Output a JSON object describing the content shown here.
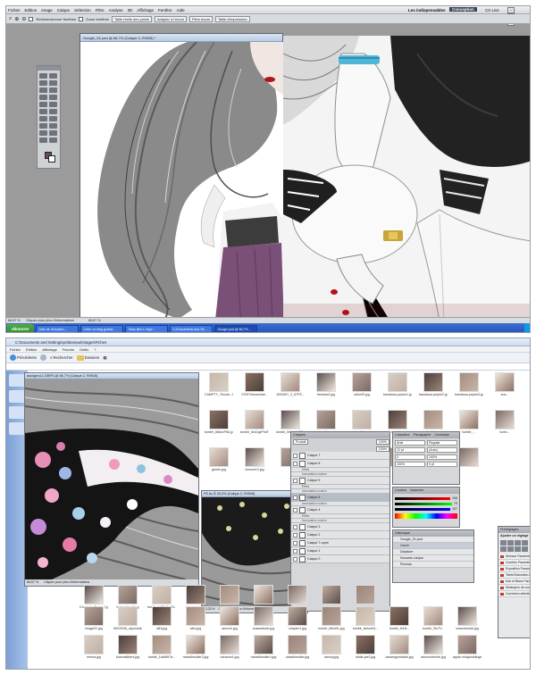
{
  "photoshop": {
    "menu": [
      "Fichier",
      "Edition",
      "Image",
      "Calque",
      "Sélection",
      "Filtre",
      "Analyse",
      "3D",
      "Affichage",
      "Fenêtre",
      "Aide"
    ],
    "workspace": [
      "Les indispensables",
      "Conception"
    ],
    "cs_live": "CS Live",
    "options": {
      "antialias_label": "Redimensionner fenêtres",
      "zoom_all_label": "Zoom fenêtres",
      "btn_actual_pixels": "Taille réelle des pixels",
      "btn_fit_screen": "Adapter à l'écran",
      "btn_fill_screen": "Plein écran",
      "btn_print_size": "Taille d'impression"
    },
    "document": {
      "title": "Google_S1.psd @ 66,7% (Calque 3, RVB/8) *"
    },
    "status": {
      "zoom": "66,67 %",
      "hint": "Cliquez pour plus d'informations",
      "zoom2": "66,67 %"
    },
    "taskbar": {
      "start": "démarrer",
      "tasks": [
        "Aide de réception...",
        "Créer un blog gratuit...",
        "Sans titre-1 img2...",
        "C:\\Documents and Se...",
        "Google.psd @ 66,7%..."
      ],
      "clock": ""
    },
    "colors": {
      "foreground": "#6a4a66",
      "accent_blue": "#2452b8"
    }
  },
  "explorer": {
    "title": "C:\\Documents and Settings\\pc\\Bureau\\Images\\Fiches",
    "menu": [
      "Fichier",
      "Edition",
      "Affichage",
      "Favoris",
      "Outils",
      "?"
    ],
    "toolbar": {
      "back": "Précédente",
      "search": "Rechercher",
      "folders": "Dossiers"
    },
    "address": "",
    "doc_left_title": "backgrnd-1.GBPS @ 66,7% (Calque 2, RVB/8)",
    "doc_left_status": "Cliquez pour plus d'informations",
    "doc_left_zoom": "66,67 %",
    "doc_mid_title": "PS bc Ã 33,3% (Calque 2, RVB/8)",
    "doc_mid_status": "Cliquez pour plus d'informations",
    "doc_mid_zoom": "33,33 %",
    "thumbs_row1": [
      "CAMPTY_Thumb..JPG",
      "070974iriseshah...",
      "1002697_2_6TFE...",
      "freedsic2.jpg",
      "robin05.jpg",
      "bandiana-pepee1.jpg",
      "bandiana-pepee2.jpg",
      "bandiana-pepee3.jpg",
      "ima..."
    ],
    "thumbs_row2": [
      "tumblr_8dbzvFfk1.jpg",
      "tumblr_lbnOgzPhcF...",
      "tumblr_lhhmrxyHCs...",
      "tumblr_...",
      "tumblr_...",
      "tumblr_..",
      "tumblr_...",
      "tumblr_...",
      "tumb..."
    ],
    "thumbs_row3": [
      "greetn.jpg",
      "ckmom12.jpg",
      "",
      "",
      "",
      "",
      "",
      ""
    ],
    "thumbs_bottom_row1": [
      "Charlotte_Tusso_t.jpg",
      "babychilon4.jpg",
      "tumblr_lx87b8kaZ1..",
      "",
      "",
      "",
      "",
      "",
      ""
    ],
    "thumbs_bottom_row2": [
      "image02.jpg",
      "IMG0036_ukphotology...",
      "ulfrk.jpg",
      "alex.jpg",
      "aenoch.jpg",
      "susantdude.jpg",
      "chapter1.jpg",
      "tumblr_l6fctl3L.jpg",
      "tumblr_la0cwK4...",
      "tumblr_lb1N...",
      "tumblr_lSuTV...",
      "wnwcdonald.jpg"
    ],
    "thumbs_bottom_row3": [
      "emma.jpg",
      "bukmaldbers.jpg",
      "tumblr_1da5tH7a...",
      "naradhmuller2.jpg",
      "ndraoon1.jpg",
      "naradhmuller4.jpg",
      "naradhmuller.jpg",
      "arseny.jpg",
      "riddle-joe2.jpg",
      "zanamgumfaldo.jpg",
      "amorvisitrofre.jpg",
      "apple-midglouthinge.."
    ]
  },
  "layers_panel": {
    "tabs": "Calques",
    "blend": "Produit",
    "opacity": "100%",
    "fill": "100%",
    "layers": [
      {
        "name": "Calque 7",
        "sub": false
      },
      {
        "name": "Calque 8",
        "sub": false
      },
      {
        "name": "Effets",
        "sub": true
      },
      {
        "name": "Incrustation couleur",
        "sub": true
      },
      {
        "name": "Calque 5",
        "sub": false
      },
      {
        "name": "Effets",
        "sub": true
      },
      {
        "name": "Incrustation couleur",
        "sub": true
      },
      {
        "name": "Calque 6",
        "sub": false,
        "selected": true
      },
      {
        "name": "Incrustation couleur",
        "sub": true
      },
      {
        "name": "Calque 4",
        "sub": false
      },
      {
        "name": "Effets",
        "sub": true
      },
      {
        "name": "Incrustation couleur",
        "sub": true
      },
      {
        "name": "Calque 3",
        "sub": false
      },
      {
        "name": "Calque 2",
        "sub": false
      },
      {
        "name": "Calque 7 copie",
        "sub": false
      },
      {
        "name": "Calque 1",
        "sub": false
      },
      {
        "name": "Calque 0",
        "sub": false
      }
    ]
  },
  "char_panel": {
    "tabs": "Caractère",
    "tab2": "Paragraphe",
    "tab3": "Contraste",
    "font": "Arial",
    "style": "Regular",
    "size": "12 pt",
    "leading": "(Auto)",
    "tracking": "0",
    "scale_v": "100%",
    "scale_h": "100%",
    "baseline": "0 pt"
  },
  "color_panel": {
    "tab": "Couleur",
    "tab2": "Nuancier",
    "r": "108",
    "g": "79",
    "b": "107"
  },
  "history_panel": {
    "tab": "Historique",
    "items": [
      "Google_S1.psd",
      "Ouvrir",
      "Déplacer",
      "Nouveau calque",
      "Pinceau"
    ]
  },
  "actions_panel": {
    "tab": "Préréglages",
    "title": "Ajuster un réglage",
    "rows": [
      "Niveaux Paramètre prédéfini",
      "Courbes Paramètre prédéfini",
      "Exposition Paramètre prédéfini",
      "Teinte/Saturation Paramètre",
      "Noir et Blanc Paramètre pré...",
      "Mélangeur de couches Param..",
      "Correction sélective Param..."
    ]
  }
}
